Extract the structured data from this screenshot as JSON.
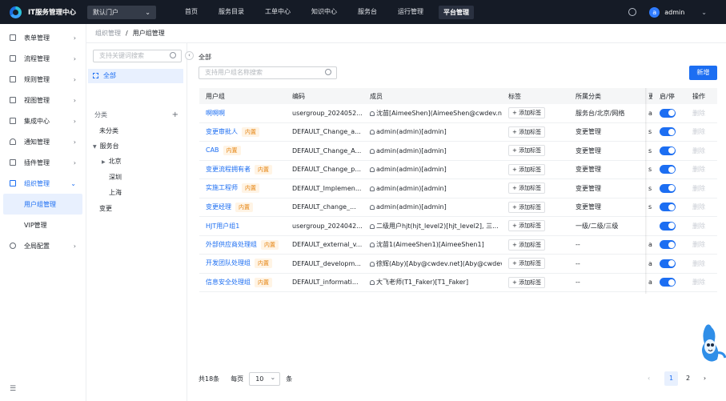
{
  "app": {
    "title": "IT服务管理中心",
    "portal": "默认门户"
  },
  "nav": [
    "首页",
    "服务目录",
    "工单中心",
    "知识中心",
    "服务台",
    "运行管理",
    "平台管理"
  ],
  "nav_active": "平台管理",
  "user": {
    "avatar": "a",
    "name": "admin"
  },
  "sidebar": {
    "items": [
      "表单管理",
      "流程管理",
      "规则管理",
      "视图管理",
      "集成中心",
      "通知管理",
      "插件管理",
      "组织管理",
      "全局配置"
    ],
    "sub_items": [
      "用户组管理",
      "VIP管理"
    ]
  },
  "breadcrumb": {
    "parent": "组织管理",
    "current": "用户组管理"
  },
  "tree": {
    "search_placeholder": "支持关键词搜索",
    "all": "全部",
    "category_header": "分类",
    "nodes": [
      "未分类",
      "服务台",
      "北京",
      "深圳",
      "上海",
      "变更"
    ]
  },
  "content": {
    "title": "全部",
    "search_placeholder": "支持用户组名称搜索",
    "new_button": "新增"
  },
  "table": {
    "headers": [
      "用户组",
      "编码",
      "成员",
      "标签",
      "所属分类",
      "更",
      "启/停",
      "操作"
    ],
    "add_tag": "添加标签",
    "builtin_tag": "内置",
    "delete": "删除",
    "rows": [
      {
        "name": "啊啊啊",
        "builtin": false,
        "code": "usergroup_2024052...",
        "members": "沈苗[AimeeShen](AimeeShen@cwdev.n...",
        "category": "服务台/北京/网络",
        "extra": "a"
      },
      {
        "name": "变更审批人",
        "builtin": true,
        "code": "DEFAULT_Change_a...",
        "members": "admin(admin)[admin]",
        "category": "变更管理",
        "extra": "s"
      },
      {
        "name": "CAB",
        "builtin": true,
        "code": "DEFAULT_Change_A...",
        "members": "admin(admin)[admin]",
        "category": "变更管理",
        "extra": "s"
      },
      {
        "name": "变更流程拥有者",
        "builtin": true,
        "code": "DEFAULT_Change_p...",
        "members": "admin(admin)[admin]",
        "category": "变更管理",
        "extra": "s"
      },
      {
        "name": "实施工程师",
        "builtin": true,
        "code": "DEFAULT_Implemen...",
        "members": "admin(admin)[admin]",
        "category": "变更管理",
        "extra": "s"
      },
      {
        "name": "变更经理",
        "builtin": true,
        "code": "DEFAULT_change_...",
        "members": "admin(admin)[admin]",
        "category": "变更管理",
        "extra": "s"
      },
      {
        "name": "HJT用户组1",
        "builtin": false,
        "code": "usergroup_2024042...",
        "members": "二级用户hjt(hjt_level2)[hjt_level2], 三...",
        "category": "一级/二级/三级",
        "extra": " "
      },
      {
        "name": "外部供应商处理组",
        "builtin": true,
        "code": "DEFAULT_external_v...",
        "members": "沈苗1(AimeeShen1)[AimeeShen1]",
        "category": "--",
        "extra": "a"
      },
      {
        "name": "开发团队处理组",
        "builtin": true,
        "code": "DEFAULT_developm...",
        "members": "徐辉(Aby)[Aby@cwdev.net](Aby@cwdev...",
        "category": "--",
        "extra": "a"
      },
      {
        "name": "信息安全处理组",
        "builtin": true,
        "code": "DEFAULT_informati...",
        "members": "大飞老师(T1_Faker)[T1_Faker]",
        "category": "--",
        "extra": "a"
      }
    ]
  },
  "footer": {
    "total": "共18条",
    "per_page_label": "每页",
    "per_page": "10",
    "unit": "条",
    "pages": [
      "1",
      "2"
    ],
    "current_page": "1"
  },
  "colors": {
    "primary": "#1c6ef2",
    "topbar": "#151b26",
    "builtin_tag": "#e5830f"
  }
}
